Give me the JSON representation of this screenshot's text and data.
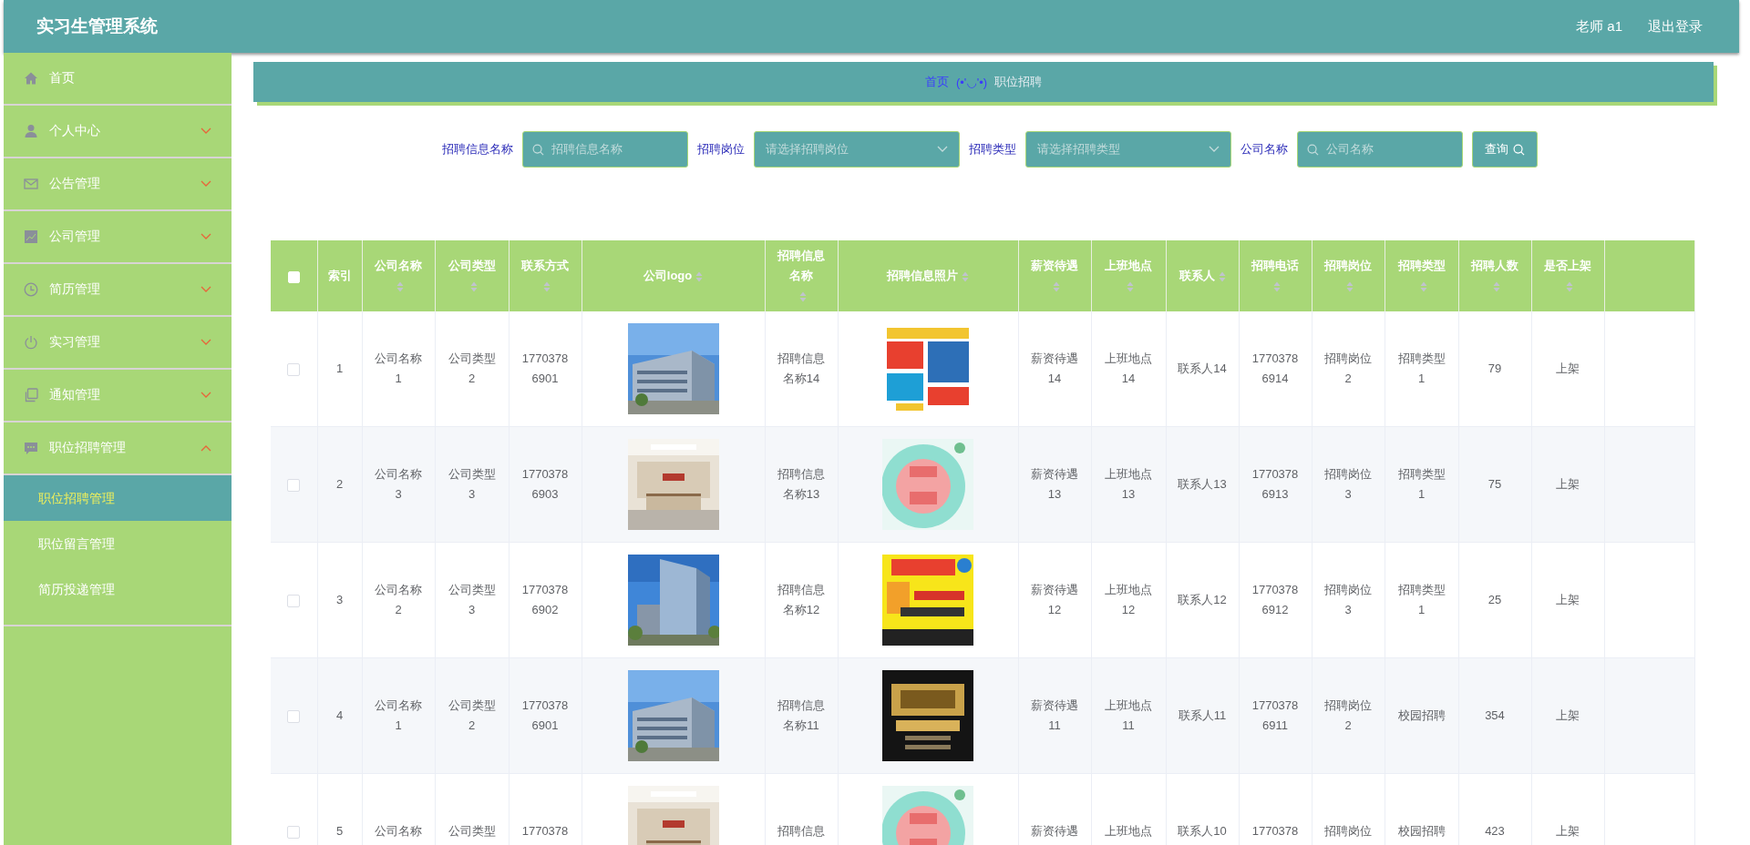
{
  "header": {
    "title": "实习生管理系统",
    "user": "老师 a1",
    "logout": "退出登录"
  },
  "sidebar": {
    "items": [
      {
        "label": "首页",
        "kind": "link"
      },
      {
        "label": "个人中心",
        "kind": "group",
        "expanded": false
      },
      {
        "label": "公告管理",
        "kind": "group",
        "expanded": false
      },
      {
        "label": "公司管理",
        "kind": "group",
        "expanded": false
      },
      {
        "label": "简历管理",
        "kind": "group",
        "expanded": false
      },
      {
        "label": "实习管理",
        "kind": "group",
        "expanded": false
      },
      {
        "label": "通知管理",
        "kind": "group",
        "expanded": false
      },
      {
        "label": "职位招聘管理",
        "kind": "group",
        "expanded": true,
        "children": [
          {
            "label": "职位招聘管理",
            "selected": true
          },
          {
            "label": "职位留言管理",
            "selected": false
          },
          {
            "label": "简历投递管理",
            "selected": false
          }
        ]
      }
    ]
  },
  "breadcrumb": {
    "home": "首页",
    "separator": "(•'◡'•)",
    "current": "职位招聘"
  },
  "search": {
    "fields": [
      {
        "label": "招聘信息名称",
        "kind": "text",
        "placeholder": "招聘信息名称"
      },
      {
        "label": "招聘岗位",
        "kind": "select",
        "placeholder": "请选择招聘岗位"
      },
      {
        "label": "招聘类型",
        "kind": "select",
        "placeholder": "请选择招聘类型"
      },
      {
        "label": "公司名称",
        "kind": "text",
        "placeholder": "公司名称"
      }
    ],
    "button": "查询"
  },
  "table": {
    "columns": [
      {
        "kind": "checkbox",
        "checked": false
      },
      {
        "kind": "text",
        "label": "索引"
      },
      {
        "kind": "sortable",
        "label": "公司名称"
      },
      {
        "kind": "sortable",
        "label": "公司类型"
      },
      {
        "kind": "sortable",
        "label": "联系方式"
      },
      {
        "kind": "sortable",
        "label": "公司logo"
      },
      {
        "kind": "sortable",
        "label": "招聘信息名称"
      },
      {
        "kind": "sortable",
        "label": "招聘信息照片"
      },
      {
        "kind": "sortable",
        "label": "薪资待遇"
      },
      {
        "kind": "sortable",
        "label": "上班地点"
      },
      {
        "kind": "sortable",
        "label": "联系人"
      },
      {
        "kind": "sortable",
        "label": "招聘电话"
      },
      {
        "kind": "sortable",
        "label": "招聘岗位"
      },
      {
        "kind": "sortable",
        "label": "招聘类型"
      },
      {
        "kind": "sortable",
        "label": "招聘人数"
      },
      {
        "kind": "sortable",
        "label": "是否上架"
      },
      {
        "kind": "blank"
      }
    ],
    "rows": [
      {
        "cells": [
          {
            "kind": "checkbox",
            "checked": false
          },
          "1",
          "公司名称1",
          "公司类型2",
          "17703786901",
          {
            "kind": "picture"
          },
          "招聘信息名称14",
          {
            "kind": "picture"
          },
          "薪资待遇14",
          "上班地点14",
          "联系人14",
          "17703786914",
          "招聘岗位2",
          "招聘类型1",
          "79",
          "上架"
        ]
      },
      {
        "cells": [
          {
            "kind": "checkbox",
            "checked": false
          },
          "2",
          "公司名称3",
          "公司类型3",
          "17703786903",
          {
            "kind": "picture"
          },
          "招聘信息名称13",
          {
            "kind": "picture"
          },
          "薪资待遇13",
          "上班地点13",
          "联系人13",
          "17703786913",
          "招聘岗位3",
          "招聘类型1",
          "75",
          "上架"
        ]
      },
      {
        "cells": [
          {
            "kind": "checkbox",
            "checked": false
          },
          "3",
          "公司名称2",
          "公司类型3",
          "17703786902",
          {
            "kind": "picture"
          },
          "招聘信息名称12",
          {
            "kind": "picture"
          },
          "薪资待遇12",
          "上班地点12",
          "联系人12",
          "17703786912",
          "招聘岗位3",
          "招聘类型1",
          "25",
          "上架"
        ]
      },
      {
        "cells": [
          {
            "kind": "checkbox",
            "checked": false
          },
          "4",
          "公司名称1",
          "公司类型2",
          "17703786901",
          {
            "kind": "picture"
          },
          "招聘信息名称11",
          {
            "kind": "picture"
          },
          "薪资待遇11",
          "上班地点11",
          "联系人11",
          "17703786911",
          "招聘岗位2",
          "校园招聘",
          "354",
          "上架"
        ]
      },
      {
        "cells": [
          {
            "kind": "checkbox",
            "checked": false
          },
          "5",
          "公司名称",
          "公司类型",
          "1770378",
          {
            "kind": "picture"
          },
          "招聘信息",
          {
            "kind": "picture"
          },
          "薪资待遇",
          "上班地点",
          "联系人10",
          "1770378",
          "招聘岗位",
          "校园招聘",
          "423",
          "上架"
        ]
      }
    ]
  }
}
